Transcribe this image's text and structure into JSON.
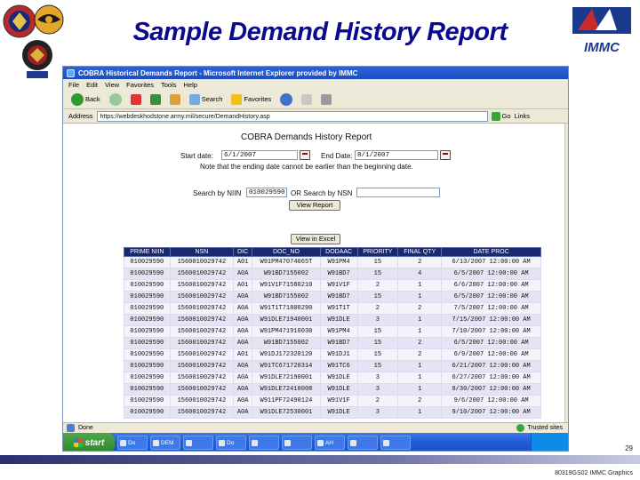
{
  "slide": {
    "title": "Sample Demand History Report",
    "page_number": "29",
    "footer_credit": "80319GS02 IMMC Graphics",
    "immc_logo_text": "IMMC",
    "colors": {
      "title": "#0a0a8c",
      "table_header": "#1a2870",
      "taskbar": "#245edb"
    }
  },
  "browser": {
    "window_title": "COBRA Historical Demands Report - Microsoft Internet Explorer provided by IMMC",
    "menu": [
      "File",
      "Edit",
      "View",
      "Favorites",
      "Tools",
      "Help"
    ],
    "toolbar": {
      "back_label": "Back",
      "search_label": "Search",
      "favorites_label": "Favorites"
    },
    "address_label": "Address",
    "address_value": "https://webdeskhodstone.army.mil/secure/DemandHistory.asp",
    "go_label": "Go",
    "links_label": "Links"
  },
  "report": {
    "heading": "COBRA Demands History Report",
    "start_date_label": "Start date:",
    "start_date_value": "6/1/2007",
    "end_date_label": "End Date:",
    "end_date_value": "8/1/2007",
    "note": "Note that the ending date cannot be earlier than the beginning date.",
    "search_niin_label": "Search by NIIN",
    "search_niin_value": "010029590",
    "search_nsn_label": "OR Search by NSN",
    "search_nsn_value": "",
    "view_report_label": "View Report",
    "view_excel_label": "View in Excel"
  },
  "table": {
    "columns": [
      "PRIME NIIN",
      "NSN",
      "DIC",
      "DOC_NO",
      "DODAAC",
      "PRIORITY",
      "FINAL QTY",
      "DATE PROC"
    ],
    "rows": [
      [
        "010029590",
        "1560010029742",
        "A01",
        "W91PM47074065T",
        "W91PM4",
        "15",
        "2",
        "6/13/2007 12:00:00 AM"
      ],
      [
        "010029590",
        "1560010029742",
        "A0A",
        "W91BD7155002",
        "W91BD7",
        "15",
        "4",
        "6/5/2007 12:00:00 AM"
      ],
      [
        "010029590",
        "1560010029742",
        "A01",
        "W91V1F71580210",
        "W91V1F",
        "2",
        "1",
        "6/6/2007 12:00:00 AM"
      ],
      [
        "010029590",
        "1560010029742",
        "A0A",
        "W91BD7155002",
        "W91BD7",
        "15",
        "1",
        "6/5/2007 12:00:00 AM"
      ],
      [
        "010029590",
        "1560010029742",
        "A0A",
        "W91T1T71800290",
        "W91T1T",
        "2",
        "2",
        "7/5/2007 12:00:00 AM"
      ],
      [
        "010029590",
        "1560010029742",
        "A0A",
        "W91DLE71940001",
        "W91DLE",
        "3",
        "1",
        "7/15/2007 12:00:00 AM"
      ],
      [
        "010029590",
        "1560010029742",
        "A0A",
        "W91PM471910030",
        "W91PM4",
        "15",
        "1",
        "7/10/2007 12:00:00 AM"
      ],
      [
        "010029590",
        "1560010029742",
        "A0A",
        "W91BD7155002",
        "W91BD7",
        "15",
        "2",
        "6/5/2007 12:00:00 AM"
      ],
      [
        "010029590",
        "1560010029742",
        "A01",
        "W91DJ172320120",
        "W91DJ1",
        "15",
        "2",
        "6/9/2007 12:00:00 AM"
      ],
      [
        "010029590",
        "1560010029742",
        "A0A",
        "W91TC671720314",
        "W91TC6",
        "15",
        "1",
        "6/21/2007 12:00:00 AM"
      ],
      [
        "010029590",
        "1560010029742",
        "A0A",
        "W91DLE72190001",
        "W91DLE",
        "3",
        "1",
        "6/27/2007 12:00:00 AM"
      ],
      [
        "010029590",
        "1560010029742",
        "A0A",
        "W91DLE72410008",
        "W91DLE",
        "3",
        "1",
        "8/30/2007 12:00:00 AM"
      ],
      [
        "010029590",
        "1560010029742",
        "A0A",
        "W911PF72490124",
        "W91V1F",
        "2",
        "2",
        "9/6/2007 12:00:00 AM"
      ],
      [
        "010029590",
        "1560010029742",
        "A0A",
        "W91DLE72530001",
        "W91DLE",
        "3",
        "1",
        "9/10/2007 12:00:00 AM"
      ]
    ]
  },
  "statusbar": {
    "left": "Done",
    "zone": "Trusted sites"
  },
  "taskbar": {
    "start_label": "start",
    "items": [
      "Do",
      "DEM",
      "",
      "Do",
      "",
      "",
      "AH",
      "",
      ""
    ]
  }
}
